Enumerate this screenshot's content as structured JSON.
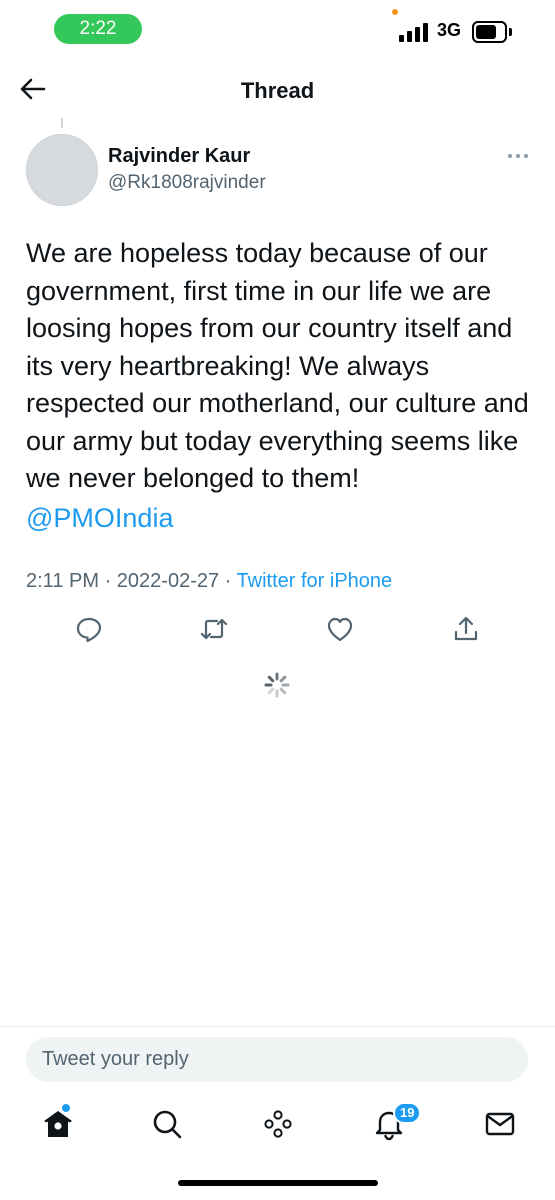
{
  "status_bar": {
    "time": "2:22",
    "network": "3G",
    "signal_bars": 4,
    "battery_level": 0.6,
    "colors": {
      "time_pill": "#34c759",
      "privacy_dot": "#f7931a"
    }
  },
  "header": {
    "back_icon": "arrow-left-icon",
    "title": "Thread"
  },
  "tweet": {
    "author": {
      "name": "Rajvinder Kaur",
      "handle": "@Rk1808rajvinder",
      "avatar": "default-avatar"
    },
    "more_icon": "more-horizontal-icon",
    "text": "We are hopeless today because of our government, first time in our life we are loosing hopes from our country itself and its very heartbreaking! We always respected our motherland, our culture and our army but today everything seems like we never belonged to them!",
    "mention": "@PMOIndia",
    "time": "2:11 PM",
    "separator": "·",
    "date": "2022-02-27",
    "source": "Twitter for iPhone",
    "actions": [
      {
        "name": "reply",
        "icon": "reply-icon"
      },
      {
        "name": "retweet",
        "icon": "retweet-icon"
      },
      {
        "name": "like",
        "icon": "heart-icon"
      },
      {
        "name": "share",
        "icon": "share-icon"
      }
    ]
  },
  "loading": {
    "icon": "loading-spinner-icon"
  },
  "reply": {
    "placeholder": "Tweet your reply"
  },
  "bottom_nav": {
    "items": [
      {
        "name": "home",
        "icon": "home-icon",
        "active": true,
        "has_dot": true
      },
      {
        "name": "search",
        "icon": "search-icon"
      },
      {
        "name": "spaces",
        "icon": "spaces-icon"
      },
      {
        "name": "notifications",
        "icon": "bell-icon",
        "badge": "19"
      },
      {
        "name": "messages",
        "icon": "mail-icon"
      }
    ]
  },
  "colors": {
    "accent": "#1d9bf0",
    "text_primary": "#0f1419",
    "text_secondary": "#536471",
    "reply_box_bg": "#eff3f4"
  }
}
